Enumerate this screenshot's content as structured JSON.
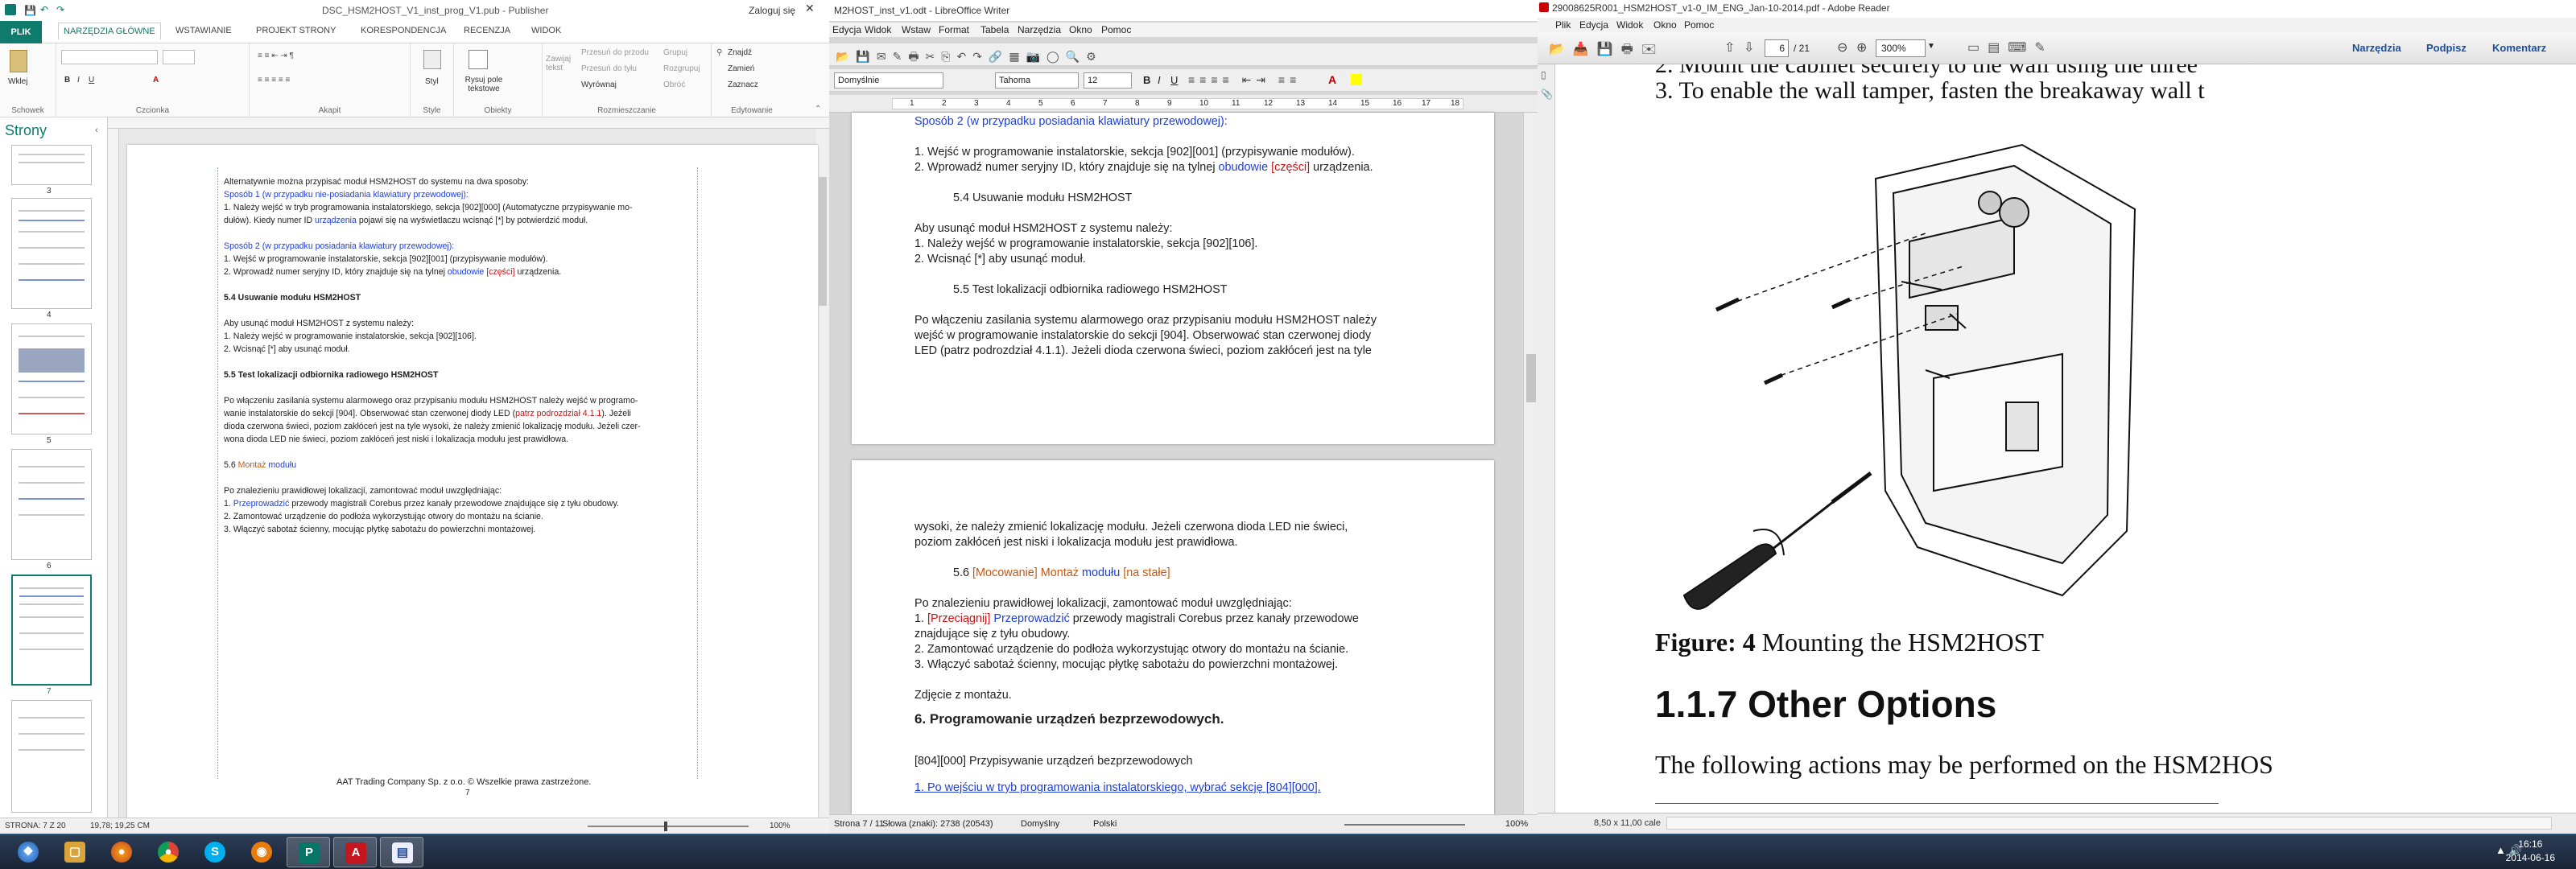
{
  "publisher": {
    "title": "DSC_HSM2HOST_V1_inst_prog_V1.pub - Publisher",
    "user": "Zaloguj się",
    "tabs": [
      "PLIK",
      "NARZĘDZIA GŁÓWNE",
      "WSTAWIANIE",
      "PROJEKT STRONY",
      "KORESPONDENCJA",
      "RECENZJA",
      "WIDOK"
    ],
    "ribbon": {
      "paste": "Wklej",
      "clipboard": "Schowek",
      "font": "Czcionka",
      "paragraph": "Akapit",
      "styles": "Style",
      "style_btn": "Styl",
      "objects": "Obiekty",
      "draw_text": "Rysuj pole tekstowe",
      "wrap_text": "Zawijaj tekst",
      "bring_forward": "Przesuń do przodu",
      "send_backward": "Przesuń do tyłu",
      "align": "Wyrównaj",
      "group": "Grupuj",
      "ungroup": "Rozgrupuj",
      "rotate": "Obróć",
      "arrange": "Rozmieszczanie",
      "find": "Znajdź",
      "replace": "Zamień",
      "select": "Zaznacz",
      "editing": "Edytowanie"
    },
    "pages_pane": {
      "title": "Strony",
      "page_numbers": [
        "3",
        "4",
        "5",
        "6",
        "7"
      ]
    },
    "body": {
      "l1": "Alternatywnie można przypisać moduł HSM2HOST do systemu na dwa sposoby:",
      "l2": "Sposób 1 (w przypadku nie-posiadania klawiatury przewodowej):",
      "l3a": "1. Należy wejść w tryb programowania instalatorskiego, sekcja [902][000] (Automatyczne przypisywanie mo-",
      "l3b": "dułów). Kiedy numer ID ",
      "l3c": "urządzenia",
      "l3d": " pojawi się na wyświetlaczu wcisnąć [*] by potwierdzić moduł.",
      "l4": "Sposób 2 (w przypadku posiadania klawiatury przewodowej):",
      "l5": "1. Wejść w programowanie instalatorskie, sekcja [902][001] (przypisywanie modułów).",
      "l6a": "2. Wprowadź numer seryjny ID, który znajduje się na tylnej ",
      "l6b": "obudowie",
      "l6c": " [części]",
      "l6d": " urządzenia.",
      "h54": "5.4 Usuwanie modułu HSM2HOST",
      "l7": "Aby usunąć moduł HSM2HOST z systemu należy:",
      "l8": "1. Należy wejść w programowanie instalatorskie, sekcja [902][106].",
      "l9": "2. Wcisnąć [*] aby usunąć moduł.",
      "h55": "5.5 Test lokalizacji odbiornika radiowego HSM2HOST",
      "l10": "Po włączeniu zasilania systemu alarmowego oraz przypisaniu  modułu  HSM2HOST należy wejść w programo-",
      "l11a": "wanie instalatorskie do sekcji [904]. Obserwować stan czerwonej diody LED (",
      "l11b": "patrz podrozdział 4.1.1",
      "l11c": "). Jeżeli",
      "l12": "dioda czerwona świeci, poziom zakłóceń jest na tyle wysoki, że należy zmienić lokalizację modułu. Jeżeli czer-",
      "l13": "wona dioda LED nie świeci, poziom zakłóceń jest niski i lokalizacja modułu jest prawidłowa.",
      "h56a": "5.6 ",
      "h56b": "Montaż ",
      "h56c": "modułu",
      "l14": "Po znalezieniu prawidłowej lokalizacji, zamontować moduł uwzględniając:",
      "l15a": "1. ",
      "l15b": "Przeprowadzić",
      "l15c": " przewody magistrali Corebus przez kanały przewodowe znajdujące się z tyłu obudowy.",
      "l16": "2. Zamontować urządzenie do podłoża wykorzystując otwory do montażu na ścianie.",
      "l17": "3. Włączyć sabotaż ścienny, mocując płytkę sabotażu do powierzchni montażowej.",
      "footer": "AAT Trading Company Sp. z o.o.   ©    Wszelkie prawa zastrzeżone.",
      "page_no": "7"
    },
    "status": {
      "page": "STRONA: 7 Z 20",
      "pos": "19,78; 19,25 CM",
      "zoom": "100%"
    }
  },
  "writer": {
    "title": "M2HOST_inst_v1.odt - LibreOffice Writer",
    "menu": [
      "Edycja",
      "Widok",
      "Wstaw",
      "Format",
      "Tabela",
      "Narzędzia",
      "Okno",
      "Pomoc"
    ],
    "style": "Domyślnie",
    "font": "Tahoma",
    "size": "12",
    "ruler": [
      "1",
      "2",
      "3",
      "4",
      "5",
      "6",
      "7",
      "8",
      "9",
      "10",
      "11",
      "12",
      "13",
      "14",
      "15",
      "16",
      "17",
      "18"
    ],
    "page1": {
      "s2": "Sposób 2 (w przypadku posiadania klawiatury przewodowej):",
      "a1": "1. Wejść w programowanie instalatorskie, sekcja [902][001] (przypisywanie modułów).",
      "a2a": "2. Wprowadź numer seryjny ID, który znajduje się na tylnej ",
      "a2b": "obudowie",
      "a2c": " [części]",
      "a2d": " urządzenia.",
      "h54": "5.4 Usuwanie modułu HSM2HOST",
      "b0": "Aby usunąć moduł HSM2HOST z systemu należy:",
      "b1": "1. Należy wejść w programowanie instalatorskie, sekcja [902][106].",
      "b2": "2. Wcisnąć [*] aby usunąć moduł.",
      "h55": "5.5 Test lokalizacji odbiornika radiowego HSM2HOST",
      "c1": "Po włączeniu zasilania systemu alarmowego oraz przypisaniu modułu HSM2HOST należy",
      "c2": "wejść w programowanie instalatorskie do sekcji [904]. Obserwować stan czerwonej diody",
      "c3": "LED (patrz podrozdział 4.1.1). Jeżeli dioda czerwona świeci, poziom zakłóceń jest na tyle"
    },
    "page2": {
      "d1": "wysoki, że należy zmienić lokalizację modułu. Jeżeli czerwona dioda LED nie świeci,",
      "d2": "poziom zakłóceń jest niski i lokalizacja modułu jest prawidłowa.",
      "h56a": "5.6 ",
      "h56b": "[Mocowanie] Montaż",
      "h56c": " modułu",
      "h56d": " [na stałe]",
      "e0": "Po znalezieniu prawidłowej lokalizacji, zamontować moduł uwzględniając:",
      "e1a": "1. ",
      "e1b": "[Przeciągnij]",
      "e1c": " Przeprowadzić",
      "e1d": " przewody magistrali Corebus przez kanały przewodowe",
      "e2": "znajdujące się z tyłu obudowy.",
      "e3": "2. Zamontować urządzenie do podłoża wykorzystując otwory do montażu na ścianie.",
      "e4": "3. Włączyć sabotaż ścienny, mocując płytkę sabotażu do powierzchni montażowej.",
      "f0": "Zdjęcie z montażu.",
      "h6": "6. Programowanie urządzeń bezprzewodowych.",
      "g0": "[804][000] Przypisywanie urządzeń bezprzewodowych",
      "g1": "1. Po wejściu w tryb programowania instalatorskiego, wybrać sekcję [804][000]."
    },
    "status": {
      "page": "Strona 7 / 11",
      "words": "Słowa (znaki): 2738 (20543)",
      "style": "Domyślny",
      "lang": "Polski",
      "zoom": "100%"
    }
  },
  "reader": {
    "title": "29008625R001_HSM2HOST_v1-0_IM_ENG_Jan-10-2014.pdf - Adobe Reader",
    "menu": [
      "Plik",
      "Edycja",
      "Widok",
      "Okno",
      "Pomoc"
    ],
    "page_input": "6",
    "page_total": "/ 21",
    "zoom": "300%",
    "tools": "Narzędzia",
    "sign": "Podpisz",
    "comment": "Komentarz",
    "doc": {
      "line2": "2.     Mount the cabinet securely to the wall using the three",
      "line3": "3.     To enable the wall tamper, fasten the breakaway wall t",
      "fig_label": "Figure: 4",
      "fig_title": " Mounting the HSM2HOST",
      "heading": "1.1.7 Other Options",
      "para": "The following actions may be performed on the HSM2HOS"
    },
    "status": {
      "size": "8,50 x 11,00 cale"
    }
  },
  "taskbar": {
    "apps": [
      "start",
      "explorer",
      "firefox",
      "chrome",
      "skype",
      "blender",
      "publisher",
      "acrobat",
      "writer"
    ],
    "time": "16:16",
    "date": "2014-06-16"
  }
}
